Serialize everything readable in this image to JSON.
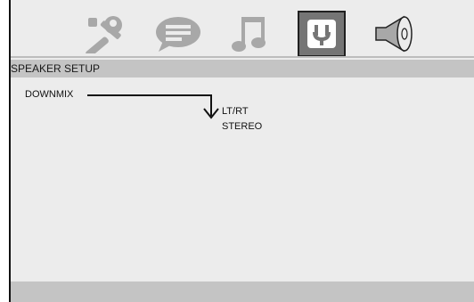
{
  "toolbar": {
    "icons": [
      {
        "name": "general-setup",
        "icon": "wrench-screwdriver-icon",
        "active": false
      },
      {
        "name": "language-setup",
        "icon": "speech-bubble-icon",
        "active": false
      },
      {
        "name": "audio-setup",
        "icon": "music-note-icon",
        "active": false
      },
      {
        "name": "speaker-setup",
        "icon": "speaker-connector-icon",
        "active": true
      },
      {
        "name": "volume",
        "icon": "loudspeaker-icon",
        "active": false
      }
    ]
  },
  "section": {
    "title": "SPEAKER SETUP"
  },
  "menu": {
    "downmix_label": "DOWNMIX",
    "options": [
      "LT/RT",
      "STEREO"
    ]
  },
  "colors": {
    "screen_bg": "#ececec",
    "bar_bg": "#c4c4c4",
    "active_icon_bg": "#757575",
    "icon_color": "#a8a8a8"
  }
}
